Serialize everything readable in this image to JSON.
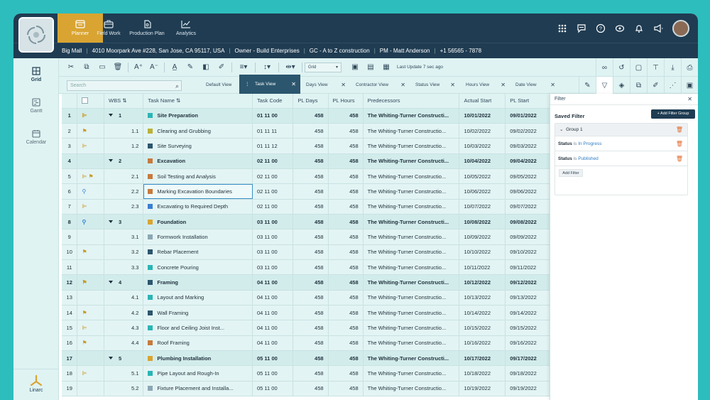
{
  "nav": {
    "tabs": [
      {
        "label": "Planner",
        "active": true
      },
      {
        "label": "Field Work"
      },
      {
        "label": "Production Plan"
      },
      {
        "label": "Analytics"
      }
    ]
  },
  "infobar": {
    "project": "Big Mall",
    "address": "4010 Moorpark Ave #228, San Jose, CA 95117, USA",
    "owner": "Owner - Build Enterprises",
    "gc": "GC - A to Z construction",
    "pm": "PM - Matt Anderson",
    "phone": "+1 56565 - 7878"
  },
  "sidebar": {
    "items": [
      {
        "label": "Grid",
        "active": true
      },
      {
        "label": "Gantt"
      },
      {
        "label": "Calendar"
      }
    ],
    "brand": "Linarc"
  },
  "toolbar": {
    "grid_select": "Grid",
    "last_update": "Last Update 7 sec ago"
  },
  "views": {
    "search_placeholder": "Search",
    "tabs": [
      "Default View",
      "Task View",
      "Days View",
      "Contractor View",
      "Status View",
      "Hours View",
      "Date View"
    ],
    "active": "Task View"
  },
  "grid": {
    "columns": [
      "WBS",
      "Task Name",
      "Task Code",
      "PL Days",
      "PL Hours",
      "Predecessors",
      "Actual Start",
      "PL Start"
    ],
    "rows": [
      {
        "n": "1",
        "ind": "gantt",
        "wbs": "1",
        "name": "Site Preparation",
        "color": "#2ab5b5",
        "code": "01 11 00",
        "days": "458",
        "hours": "458",
        "pred": "The Whiting-Turner Constructi...",
        "as": "10/01/2022",
        "ps": "09/01/2022",
        "parent": true
      },
      {
        "n": "2",
        "ind": "flag",
        "wbs": "1.1",
        "name": "Clearing and Grubbing",
        "color": "#b9b23a",
        "code": "01 11 11",
        "days": "458",
        "hours": "458",
        "pred": "The Whiting-Turner Constructio...",
        "as": "10/02/2022",
        "ps": "09/02/2022"
      },
      {
        "n": "3",
        "ind": "gantt",
        "wbs": "1.2",
        "name": "Site Surveying",
        "color": "#2c566e",
        "code": "01 11 12",
        "days": "458",
        "hours": "458",
        "pred": "The Whiting-Turner Constructio...",
        "as": "10/03/2022",
        "ps": "09/03/2022"
      },
      {
        "n": "4",
        "ind": "",
        "wbs": "2",
        "name": "Excavation",
        "color": "#c87a3c",
        "code": "02 11 00",
        "days": "458",
        "hours": "458",
        "pred": "The Whiting-Turner Constructi...",
        "as": "10/04/2022",
        "ps": "09/04/2022",
        "parent": true
      },
      {
        "n": "5",
        "ind": "gantt-flag",
        "wbs": "2.1",
        "name": "Soil Testing and Analysis",
        "color": "#c87a3c",
        "code": "02 11 00",
        "days": "458",
        "hours": "458",
        "pred": "The Whiting-Turner Constructio...",
        "as": "10/05/2022",
        "ps": "09/05/2022"
      },
      {
        "n": "6",
        "ind": "signal",
        "wbs": "2.2",
        "name": "Marking Excavation Boundaries",
        "color": "#c87a3c",
        "code": "02 11 00",
        "days": "458",
        "hours": "458",
        "pred": "The Whiting-Turner Constructio...",
        "as": "10/06/2022",
        "ps": "09/06/2022",
        "selected": true
      },
      {
        "n": "7",
        "ind": "gantt",
        "wbs": "2.3",
        "name": "Excavating to Required Depth",
        "color": "#3a7fd4",
        "code": "02 11 00",
        "days": "458",
        "hours": "458",
        "pred": "The Whiting-Turner Constructio...",
        "as": "10/07/2022",
        "ps": "09/07/2022"
      },
      {
        "n": "8",
        "ind": "signal",
        "wbs": "3",
        "name": "Foundation",
        "color": "#d9a431",
        "code": "03 11 00",
        "days": "458",
        "hours": "458",
        "pred": "The Whiting-Turner Constructi...",
        "as": "10/08/2022",
        "ps": "09/08/2022",
        "parent": true
      },
      {
        "n": "9",
        "ind": "",
        "wbs": "3.1",
        "name": "Formwork Installation",
        "color": "#8aa7b5",
        "code": "03 11 00",
        "days": "458",
        "hours": "458",
        "pred": "The Whiting-Turner Constructio...",
        "as": "10/09/2022",
        "ps": "09/09/2022"
      },
      {
        "n": "10",
        "ind": "flag",
        "wbs": "3.2",
        "name": "Rebar Placement",
        "color": "#2c566e",
        "code": "03 11 00",
        "days": "458",
        "hours": "458",
        "pred": "The Whiting-Turner Constructio...",
        "as": "10/10/2022",
        "ps": "09/10/2022"
      },
      {
        "n": "11",
        "ind": "",
        "wbs": "3.3",
        "name": "Concrete Pouring",
        "color": "#2ab5b5",
        "code": "03 11 00",
        "days": "458",
        "hours": "458",
        "pred": "The Whiting-Turner Constructio...",
        "as": "10/11/2022",
        "ps": "09/11/2022"
      },
      {
        "n": "12",
        "ind": "flag",
        "wbs": "4",
        "name": "Framing",
        "color": "#2c566e",
        "code": "04 11 00",
        "days": "458",
        "hours": "458",
        "pred": "The Whiting-Turner Constructi...",
        "as": "10/12/2022",
        "ps": "09/12/2022",
        "parent": true
      },
      {
        "n": "13",
        "ind": "",
        "wbs": "4.1",
        "name": "Layout and Marking",
        "color": "#2ab5b5",
        "code": "04 11 00",
        "days": "458",
        "hours": "458",
        "pred": "The Whiting-Turner Constructio...",
        "as": "10/13/2022",
        "ps": "09/13/2022"
      },
      {
        "n": "14",
        "ind": "flag",
        "wbs": "4.2",
        "name": "Wall Framing",
        "color": "#2c566e",
        "code": "04 11 00",
        "days": "458",
        "hours": "458",
        "pred": "The Whiting-Turner Constructio...",
        "as": "10/14/2022",
        "ps": "09/14/2022"
      },
      {
        "n": "15",
        "ind": "gantt",
        "wbs": "4.3",
        "name": "Floor and Ceiling Joist Inst...",
        "color": "#2ab5b5",
        "code": "04 11 00",
        "days": "458",
        "hours": "458",
        "pred": "The Whiting-Turner Constructio...",
        "as": "10/15/2022",
        "ps": "09/15/2022"
      },
      {
        "n": "16",
        "ind": "flag",
        "wbs": "4.4",
        "name": "Roof Framing",
        "color": "#c87a3c",
        "code": "04 11 00",
        "days": "458",
        "hours": "458",
        "pred": "The Whiting-Turner Constructio...",
        "as": "10/16/2022",
        "ps": "09/16/2022"
      },
      {
        "n": "17",
        "ind": "",
        "wbs": "5",
        "name": "Plumbing Installation",
        "color": "#d9a431",
        "code": "05 11 00",
        "days": "458",
        "hours": "458",
        "pred": "The Whiting-Turner Constructi...",
        "as": "10/17/2022",
        "ps": "09/17/2022",
        "parent": true
      },
      {
        "n": "18",
        "ind": "gantt",
        "wbs": "5.1",
        "name": "Pipe Layout and Rough-In",
        "color": "#2ab5b5",
        "code": "05 11 00",
        "days": "458",
        "hours": "458",
        "pred": "The Whiting-Turner Constructio...",
        "as": "10/18/2022",
        "ps": "09/18/2022"
      },
      {
        "n": "19",
        "ind": "",
        "wbs": "5.2",
        "name": "Fixture Placement and Installa...",
        "color": "#8aa7b5",
        "code": "05 11 00",
        "days": "458",
        "hours": "458",
        "pred": "The Whiting-Turner Constructio...",
        "as": "10/19/2022",
        "ps": "09/19/2022"
      }
    ]
  },
  "filter": {
    "title": "Filter",
    "saved_label": "Saved Filter",
    "add_group_label": "Add Filter Group",
    "group_label": "Group 1",
    "conditions": [
      {
        "field": "Status",
        "op": "is",
        "value": "In Progress"
      },
      {
        "field": "Status",
        "op": "is",
        "value": "Published"
      }
    ],
    "add_filter_label": "Add Filter"
  }
}
